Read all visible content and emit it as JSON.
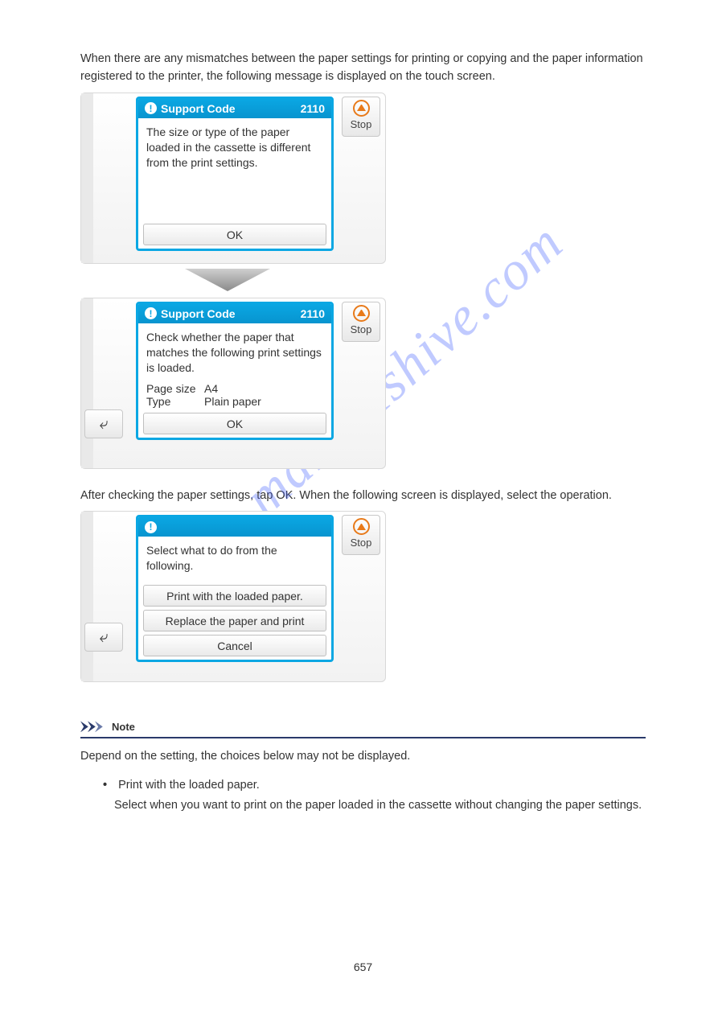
{
  "watermark": "manualshive.com",
  "intro": "When there are any mismatches between the paper settings for printing or copying and the paper information registered to the printer, the following message is displayed on the touch screen.",
  "screen1": {
    "title": "Support Code",
    "code": "2110",
    "body": "The size or type of the paper loaded in the cassette is different from the print settings.",
    "ok": "OK",
    "stop": "Stop"
  },
  "screen2": {
    "title": "Support Code",
    "code": "2110",
    "body": "Check whether the paper that matches the following print settings is loaded.",
    "rows": [
      {
        "k": "Page size",
        "v": "A4"
      },
      {
        "k": "Type",
        "v": "Plain paper"
      }
    ],
    "ok": "OK",
    "stop": "Stop",
    "back": "⤶"
  },
  "midline": "After checking the paper settings, tap OK. When the following screen is displayed, select the operation.",
  "screen3": {
    "body": "Select what to do from the following.",
    "options": [
      "Print with the loaded paper.",
      "Replace the paper and print",
      "Cancel"
    ],
    "stop": "Stop",
    "back": "⤶"
  },
  "opt1": {
    "heading": "Print with the loaded paper.",
    "body": "Select when you want to print on the paper loaded in the cassette without changing the paper settings."
  },
  "note": {
    "label": "Note",
    "body": "Depend on the setting, the choices below may not be displayed."
  },
  "page_number": "657"
}
